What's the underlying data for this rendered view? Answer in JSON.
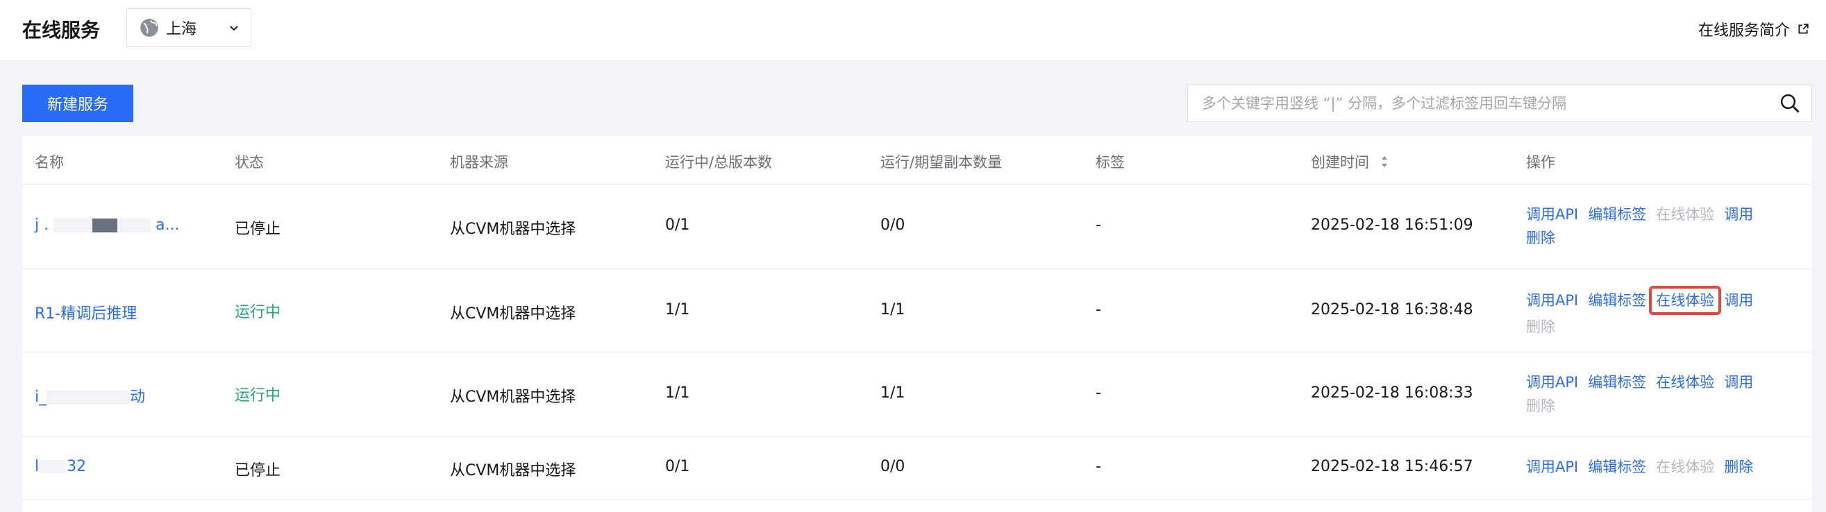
{
  "header": {
    "title": "在线服务",
    "region": "上海",
    "intro_link": "在线服务简介"
  },
  "toolbar": {
    "new_service": "新建服务",
    "search_placeholder": "多个关键字用竖线 “|” 分隔，多个过滤标签用回车键分隔"
  },
  "table": {
    "columns": {
      "name": "名称",
      "status": "状态",
      "source": "机器来源",
      "versions": "运行中/总版本数",
      "replicas": "运行/期望副本数量",
      "tags": "标签",
      "created": "创建时间",
      "actions": "操作"
    },
    "rows": [
      {
        "name_prefix": "j",
        "name_mid": ".",
        "name_suffix": "a...",
        "status": "已停止",
        "source": "从CVM机器中选择",
        "versions": "0/1",
        "replicas": "0/0",
        "tags": "-",
        "created": "2025-02-18 16:51:09",
        "ops": {
          "api": "调用API",
          "edit_tags": "编辑标签",
          "try": "在线体验",
          "call": "调用",
          "delete": "删除"
        }
      },
      {
        "name": "R1-精调后推理",
        "status": "运行中",
        "source": "从CVM机器中选择",
        "versions": "1/1",
        "replicas": "1/1",
        "tags": "-",
        "created": "2025-02-18 16:38:48",
        "ops": {
          "api": "调用API",
          "edit_tags": "编辑标签",
          "try": "在线体验",
          "call": "调用",
          "delete": "删除"
        }
      },
      {
        "name_prefix": "i_",
        "name_suffix": "动",
        "status": "运行中",
        "source": "从CVM机器中选择",
        "versions": "1/1",
        "replicas": "1/1",
        "tags": "-",
        "created": "2025-02-18 16:08:33",
        "ops": {
          "api": "调用API",
          "edit_tags": "编辑标签",
          "try": "在线体验",
          "call": "调用",
          "delete": "删除"
        }
      },
      {
        "name_prefix": "l",
        "name_suffix": "32",
        "status": "已停止",
        "source": "从CVM机器中选择",
        "versions": "0/1",
        "replicas": "0/0",
        "tags": "-",
        "created": "2025-02-18 15:46:57",
        "ops": {
          "api": "调用API",
          "edit_tags": "编辑标签",
          "try": "在线体验",
          "delete": "删除"
        }
      }
    ]
  },
  "colors": {
    "accent": "#2a6cf6",
    "running": "#2ba471",
    "disabled": "#b3b8c0",
    "highlight_border": "#e0483a"
  }
}
